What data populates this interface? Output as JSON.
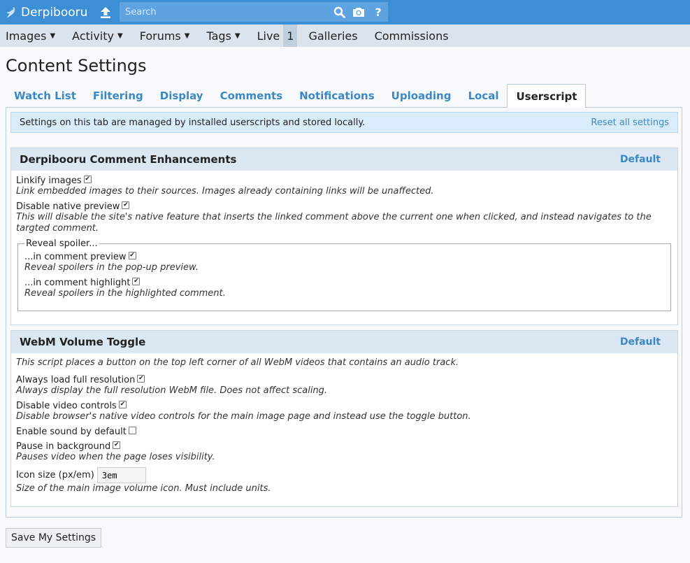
{
  "header": {
    "site_name": "Derpibooru",
    "search_placeholder": "Search",
    "icons": [
      "logo-icon",
      "upload-icon",
      "search-icon",
      "camera-icon",
      "help-icon"
    ]
  },
  "nav": {
    "items": [
      {
        "label": "Images",
        "dropdown": true
      },
      {
        "label": "Activity",
        "dropdown": true
      },
      {
        "label": "Forums",
        "dropdown": true
      },
      {
        "label": "Tags",
        "dropdown": true
      },
      {
        "label": "Live",
        "dropdown": false
      },
      {
        "label": "Galleries",
        "dropdown": false
      },
      {
        "label": "Commissions",
        "dropdown": false
      }
    ],
    "live_count": "1"
  },
  "page": {
    "title": "Content Settings"
  },
  "tabs": [
    "Watch List",
    "Filtering",
    "Display",
    "Comments",
    "Notifications",
    "Uploading",
    "Local",
    "Userscript"
  ],
  "active_tab": "Userscript",
  "notice": {
    "text": "Settings on this tab are managed by installed userscripts and stored locally.",
    "reset_label": "Reset all settings"
  },
  "sections": [
    {
      "title": "Derpibooru Comment Enhancements",
      "default_label": "Default",
      "fields": [
        {
          "label": "Linkify images",
          "checked": true,
          "help": "Link embedded images to their sources. Images already containing links will be unaffected."
        },
        {
          "label": "Disable native preview",
          "checked": true,
          "help": "This will disable the site's native feature that inserts the linked comment above the current one when clicked, and instead navigates to the targted comment."
        }
      ],
      "group": {
        "legend": "Reveal spoiler...",
        "fields": [
          {
            "label": "...in comment preview",
            "checked": true,
            "help": "Reveal spoilers in the pop-up preview."
          },
          {
            "label": "...in comment highlight",
            "checked": true,
            "help": "Reveal spoilers in the highlighted comment."
          }
        ]
      }
    },
    {
      "title": "WebM Volume Toggle",
      "default_label": "Default",
      "description": "This script places a button on the top left corner of all WebM videos that contains an audio track.",
      "fields": [
        {
          "label": "Always load full resolution",
          "checked": true,
          "help": "Always display the full resolution WebM file. Does not affect scaling."
        },
        {
          "label": "Disable video controls",
          "checked": true,
          "help": "Disable browser's native video controls for the main image page and instead use the toggle button."
        },
        {
          "label": "Enable sound by default",
          "checked": false,
          "help": ""
        },
        {
          "label": "Pause in background",
          "checked": true,
          "help": "Pauses video when the page loses visibility."
        }
      ],
      "text_field": {
        "label": "Icon size (px/em)",
        "value": "3em",
        "help": "Size of the main image volume icon. Must include units."
      }
    }
  ],
  "save_label": "Save My Settings",
  "colors": {
    "header_bg": "#3c8fd4",
    "nav_bg": "#dbe4ec",
    "link": "#3b88c4",
    "section_head": "#dbe8f4",
    "notice_bg": "#d9ecf9"
  }
}
